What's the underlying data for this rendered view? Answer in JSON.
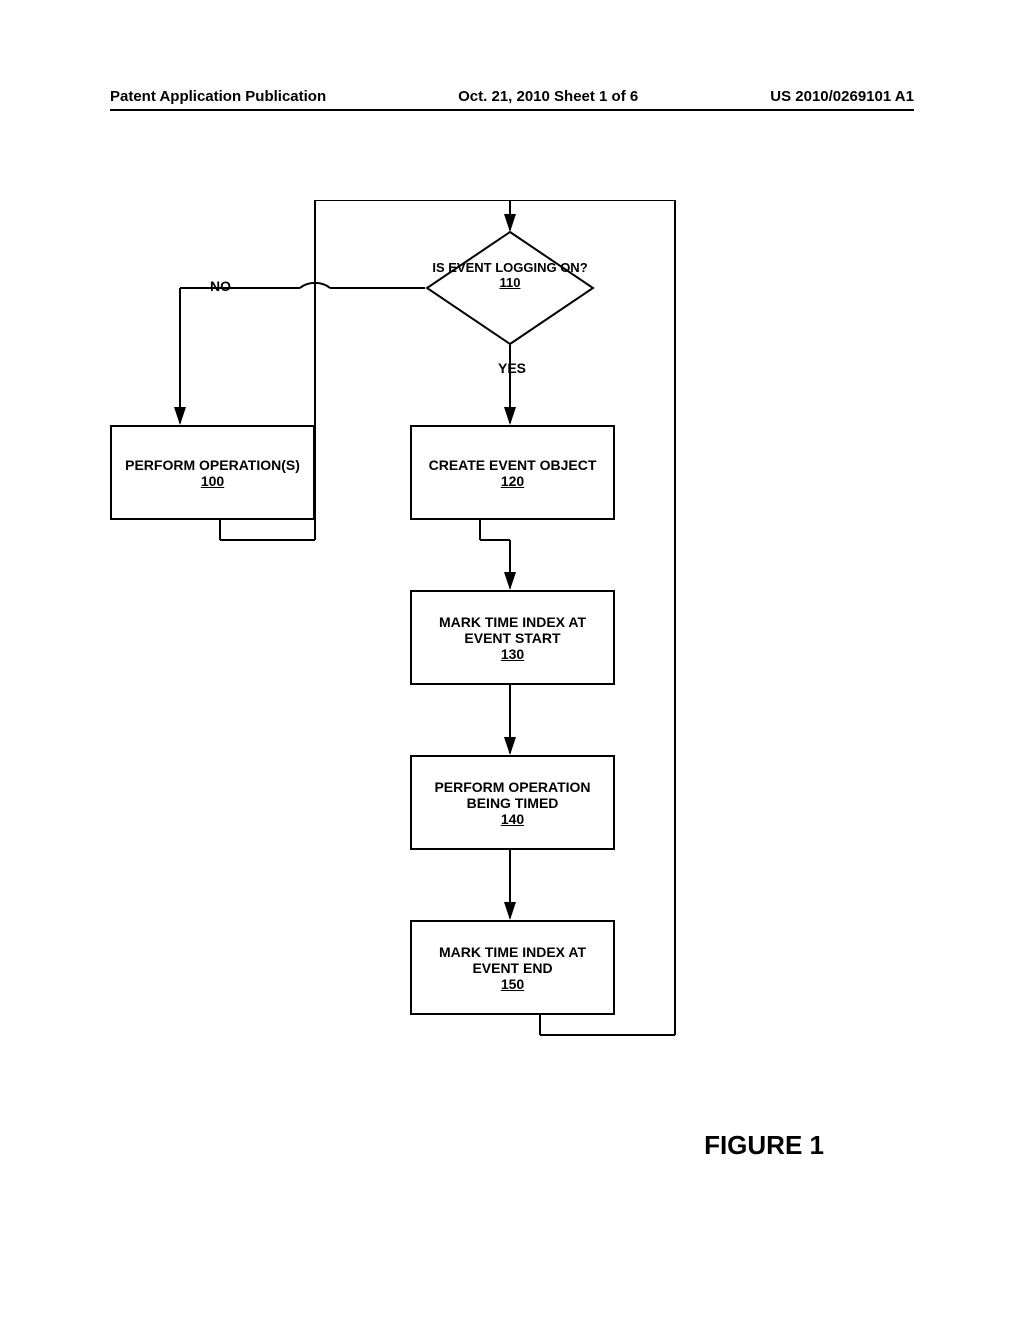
{
  "header": {
    "left": "Patent Application Publication",
    "center": "Oct. 21, 2010  Sheet 1 of 6",
    "right": "US 2010/0269101 A1"
  },
  "flowchart": {
    "decision": {
      "text": "IS EVENT LOGGING ON?",
      "num": "110"
    },
    "no_label": "NO",
    "yes_label": "YES",
    "box100": {
      "text": "PERFORM OPERATION(S)",
      "num": "100"
    },
    "box120": {
      "text": "CREATE EVENT OBJECT",
      "num": "120"
    },
    "box130": {
      "text": "MARK TIME INDEX AT EVENT START",
      "num": "130"
    },
    "box140": {
      "text": "PERFORM OPERATION BEING TIMED",
      "num": "140"
    },
    "box150": {
      "text": "MARK TIME INDEX AT EVENT END",
      "num": "150"
    }
  },
  "figure": "FIGURE 1"
}
